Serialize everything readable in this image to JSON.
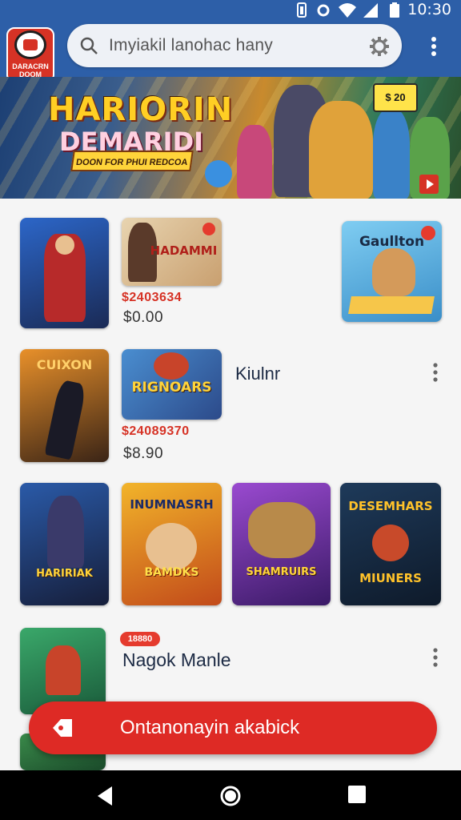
{
  "status_bar": {
    "time": "10:30"
  },
  "app_logo": {
    "text": "DARACRN DOOM"
  },
  "search": {
    "placeholder": "Imyiakil lanohac hany"
  },
  "hero": {
    "title_line1": "HARIORIN",
    "title_line2": "DEMARIDI",
    "tagline": "DOON FOR PHUI REDCOA",
    "price_badge": "$ 20"
  },
  "rows": [
    {
      "tiles": [
        {
          "caption": ""
        },
        {
          "caption": "HADAMMI"
        },
        {
          "caption": "Gaullton"
        }
      ],
      "price_red": "$2403634",
      "price_sub": "$0.00"
    },
    {
      "title": "Kiulnr",
      "tiles": [
        {
          "caption": "CUIXON"
        },
        {
          "caption": "RIGNOARS"
        }
      ],
      "price_red": "$24089370",
      "price_sub": "$8.90"
    },
    {
      "tiles": [
        {
          "caption": "HARIRIAK"
        },
        {
          "caption": "INUMNASRH",
          "sub": "BAMDKS"
        },
        {
          "caption": "SHAMRUIRS"
        },
        {
          "caption": "DESEMHARS",
          "sub": "MIUNERS"
        }
      ]
    },
    {
      "badge": "18880",
      "title": "Nagok Manle"
    }
  ],
  "cta": {
    "label": "Ontanonayin akabick"
  }
}
